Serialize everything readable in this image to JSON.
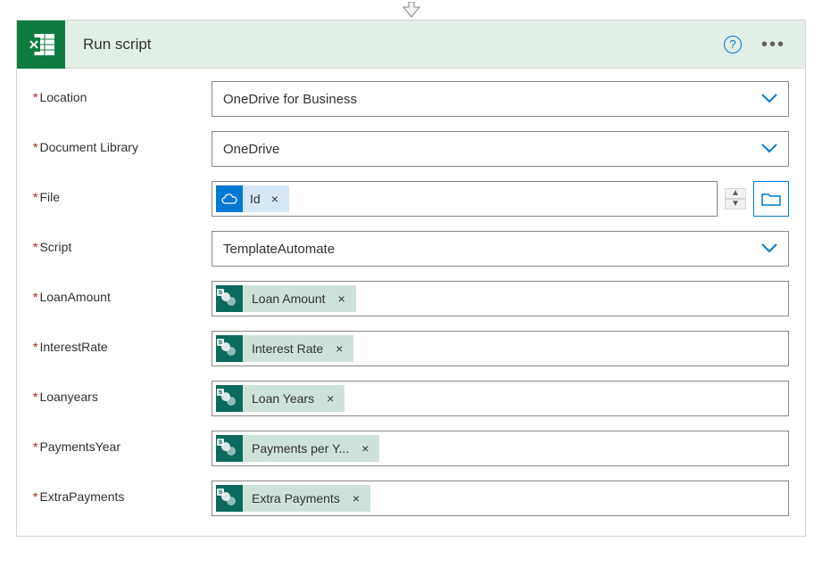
{
  "header": {
    "title": "Run script"
  },
  "fields": {
    "location": {
      "label": "Location",
      "value": "OneDrive for Business"
    },
    "library": {
      "label": "Document Library",
      "value": "OneDrive"
    },
    "file": {
      "label": "File",
      "token": "Id"
    },
    "script": {
      "label": "Script",
      "value": "TemplateAutomate"
    },
    "params": [
      {
        "label": "LoanAmount",
        "token": "Loan Amount"
      },
      {
        "label": "InterestRate",
        "token": "Interest Rate"
      },
      {
        "label": "Loanyears",
        "token": "Loan Years"
      },
      {
        "label": "PaymentsYear",
        "token": "Payments per Y..."
      },
      {
        "label": "ExtraPayments",
        "token": "Extra Payments"
      }
    ]
  }
}
